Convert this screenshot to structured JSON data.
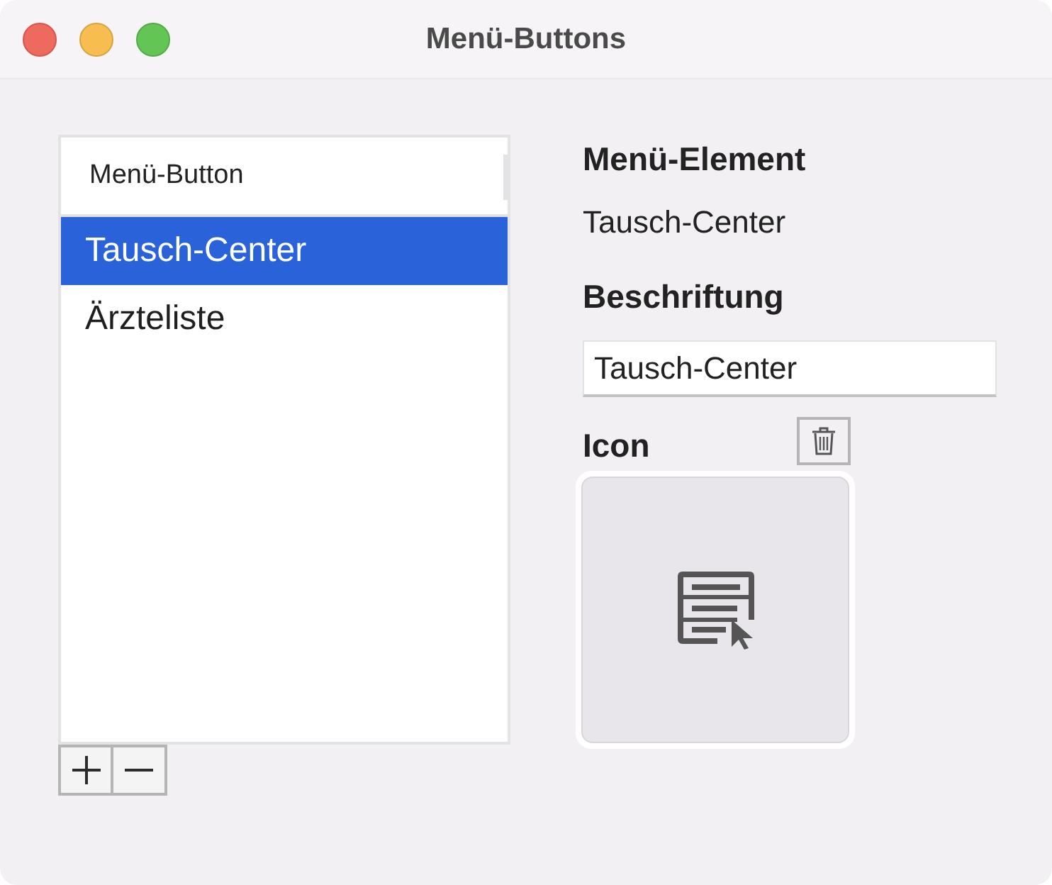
{
  "window": {
    "title": "Menü-Buttons"
  },
  "list": {
    "header": "Menü-Button",
    "items": [
      {
        "label": "Tausch-Center",
        "selected": true
      },
      {
        "label": "Ärzteliste",
        "selected": false
      }
    ],
    "controls": [
      {
        "kind": "add"
      },
      {
        "kind": "remove"
      }
    ]
  },
  "details": {
    "element_heading": "Menü-Element",
    "element_value": "Tausch-Center",
    "caption_heading": "Beschriftung",
    "caption_value": "Tausch-Center",
    "icon_heading": "Icon"
  }
}
